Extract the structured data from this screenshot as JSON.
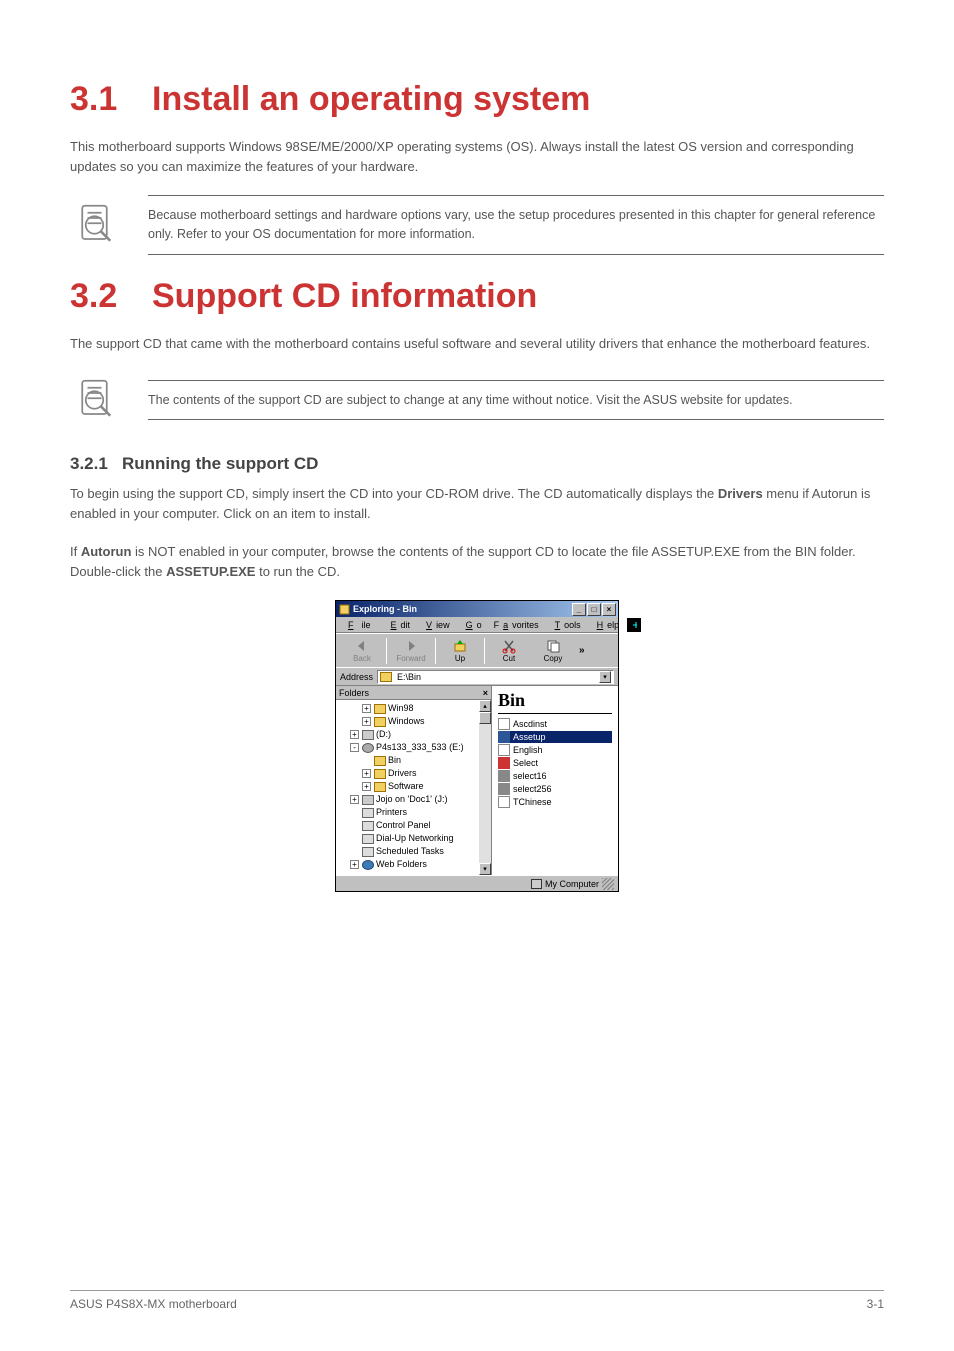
{
  "section1": {
    "num": "3.1",
    "title": "Install an operating system",
    "para": "This motherboard supports Windows 98SE/ME/2000/XP operating systems (OS). Always install the latest OS version and corresponding updates so you can maximize the features of your hardware.",
    "note": "Because motherboard settings and hardware options vary, use the setup procedures presented in this chapter for general reference only. Refer to your OS documentation for more information."
  },
  "section2": {
    "num": "3.2",
    "title": "Support CD information",
    "para": "The support CD that came with the motherboard contains useful software and several utility drivers that enhance the motherboard features.",
    "note": "The contents of the support CD are subject to change at any time without notice. Visit the ASUS website for updates.",
    "sub_num": "3.2.1",
    "sub_title": "Running the support CD",
    "run_para": "To begin using the support CD, simply insert the CD into your CD-ROM drive. The CD automatically displays the Drivers menu if Autorun is enabled in your computer. Click on an item to install.",
    "steps_intro": "If Autorun is NOT enabled in your computer, browse the contents of the support CD to locate the file ASSETUP.EXE from the BIN folder. Double-click the ASSETUP.EXE to run the CD.",
    "bold_words": {
      "drivers": "Drivers",
      "autorun": "Autorun",
      "not": "NOT",
      "bin": "BIN",
      "assetup": "ASSETUP.EXE"
    }
  },
  "explorer": {
    "title": "Exploring - Bin",
    "menu": [
      "File",
      "Edit",
      "View",
      "Go",
      "Favorites",
      "Tools",
      "Help"
    ],
    "toolbar": {
      "back": "Back",
      "forward": "Forward",
      "up": "Up",
      "cut": "Cut",
      "copy": "Copy"
    },
    "address_label": "Address",
    "address_value": "E:\\Bin",
    "folders_label": "Folders",
    "tree": [
      {
        "indent": "ind2",
        "exp": "+",
        "icon": "folder-closed",
        "label": "Win98"
      },
      {
        "indent": "ind2",
        "exp": "+",
        "icon": "folder-closed",
        "label": "Windows"
      },
      {
        "indent": "ind1",
        "exp": "+",
        "icon": "drive",
        "label": "(D:)"
      },
      {
        "indent": "ind1",
        "exp": "-",
        "icon": "cdrom",
        "label": "P4s133_333_533 (E:)"
      },
      {
        "indent": "ind2",
        "exp": "",
        "icon": "folder-open",
        "label": "Bin"
      },
      {
        "indent": "ind2",
        "exp": "+",
        "icon": "folder-closed",
        "label": "Drivers"
      },
      {
        "indent": "ind2",
        "exp": "+",
        "icon": "folder-closed",
        "label": "Software"
      },
      {
        "indent": "ind1",
        "exp": "+",
        "icon": "drive",
        "label": "Jojo on 'Doc1' (J:)"
      },
      {
        "indent": "ind1",
        "exp": "",
        "icon": "printer",
        "label": "Printers"
      },
      {
        "indent": "ind1",
        "exp": "",
        "icon": "printer",
        "label": "Control Panel"
      },
      {
        "indent": "ind1",
        "exp": "",
        "icon": "printer",
        "label": "Dial-Up Networking"
      },
      {
        "indent": "ind1",
        "exp": "",
        "icon": "printer",
        "label": "Scheduled Tasks"
      },
      {
        "indent": "ind1",
        "exp": "+",
        "icon": "globe",
        "label": "Web Folders"
      }
    ],
    "right_title": "Bin",
    "files": [
      {
        "icon": "ic-text",
        "name": "Ascdinst",
        "sel": false
      },
      {
        "icon": "ic-exe",
        "name": "Assetup",
        "sel": true
      },
      {
        "icon": "ic-text",
        "name": "English",
        "sel": false
      },
      {
        "icon": "ic-red",
        "name": "Select",
        "sel": false
      },
      {
        "icon": "ic-bin",
        "name": "select16",
        "sel": false
      },
      {
        "icon": "ic-bin",
        "name": "select256",
        "sel": false
      },
      {
        "icon": "ic-text",
        "name": "TChinese",
        "sel": false
      }
    ],
    "status": "My Computer"
  },
  "footer": {
    "left": "ASUS P4S8X-MX motherboard",
    "right": "3-1"
  }
}
